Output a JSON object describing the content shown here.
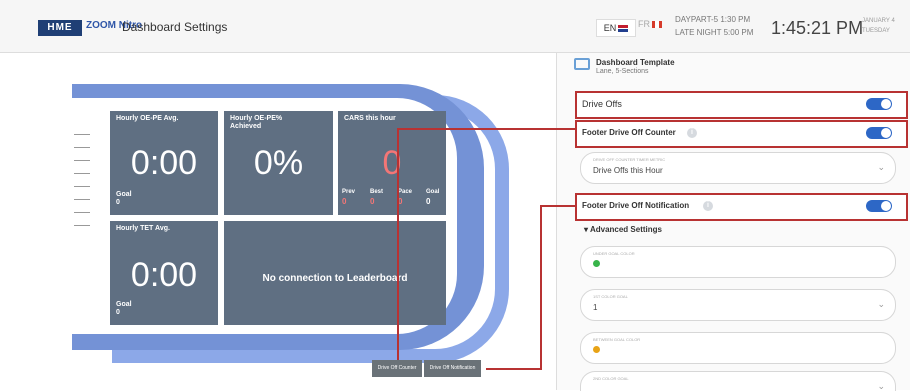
{
  "header": {
    "logo": "HME",
    "brand": "ZOOM Nitro",
    "title": "Dashboard Settings",
    "lang_en": "EN",
    "lang_fr": "FR",
    "daypart_line1": "DAYPART-5  1:30 PM",
    "daypart_line2": "LATE NIGHT  5:00 PM",
    "clock": "1:45:21 PM",
    "date_line1": "JANUARY 4",
    "date_line2": "TUESDAY"
  },
  "dashboard": {
    "tile1": {
      "title": "Hourly OE-PE Avg.",
      "value": "0:00",
      "goal_label": "Goal",
      "goal": "0"
    },
    "tile2": {
      "title_line1": "Hourly OE-PE%",
      "title_line2": "Achieved",
      "value": "0%"
    },
    "tile3": {
      "title": "CARS this hour",
      "value": "0",
      "stats": [
        {
          "label": "Prev",
          "value": "0"
        },
        {
          "label": "Best",
          "value": "0"
        },
        {
          "label": "Pace",
          "value": "0"
        },
        {
          "label": "Goal",
          "value": "0"
        }
      ]
    },
    "tile4": {
      "title": "Hourly TET Avg.",
      "value": "0:00",
      "goal_label": "Goal",
      "goal": "0"
    },
    "tile5": {
      "message": "No connection to Leaderboard"
    },
    "footer_buttons": [
      "Drive Off Counter",
      "Drive Off Notification"
    ]
  },
  "settings": {
    "template_title": "Dashboard Template",
    "template_sub": "Lane, 5-Sections",
    "drive_offs": "Drive Offs",
    "footer_counter": "Footer Drive Off Counter",
    "counter_select_label": "DRIVE OFF COUNTER TIMER METRIC",
    "counter_select_value": "Drive Offs this Hour",
    "footer_notification": "Footer Drive Off Notification",
    "advanced": "Advanced Settings",
    "under_goal": "UNDER GOAL COLOR",
    "first_goal": "1ST COLOR GOAL",
    "first_goal_value": "1",
    "between_goal": "BETWEEN GOAL COLOR",
    "second_goal": "2ND COLOR GOAL",
    "colors": {
      "green": "#38b44a",
      "orange": "#e8a316",
      "accent": "#2d67c6",
      "highlight": "#b83232"
    }
  }
}
